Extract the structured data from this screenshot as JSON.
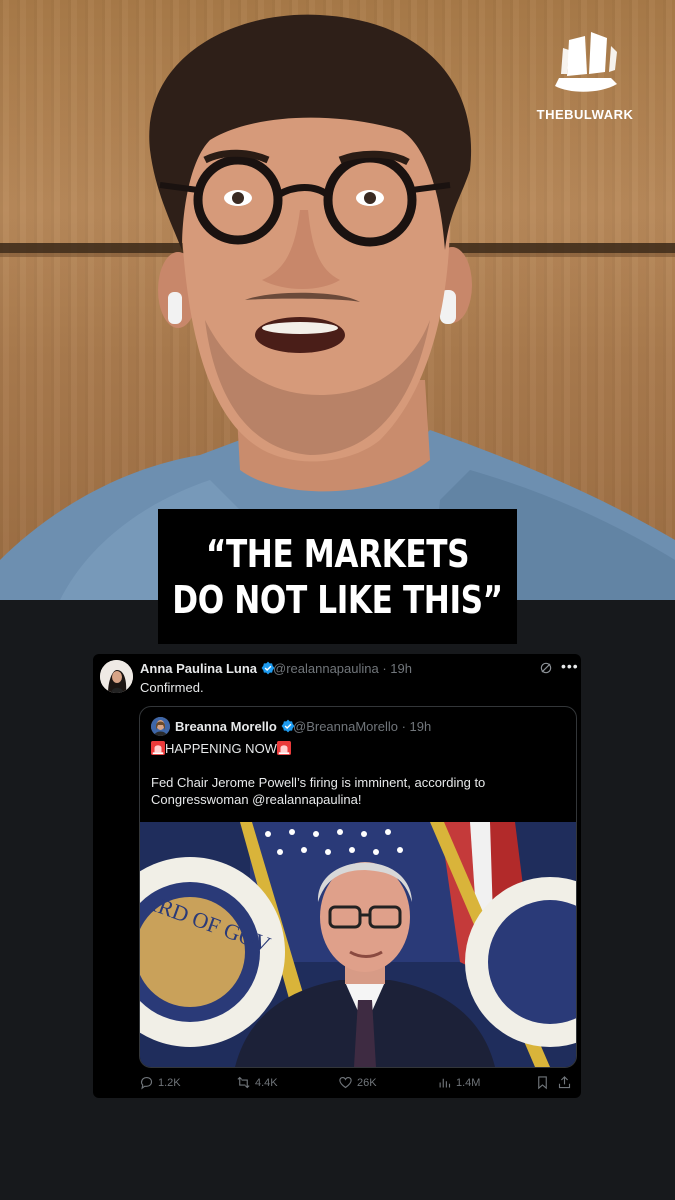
{
  "video": {
    "logo_text": "THEBULWARK",
    "caption_line1": "“THE MARKETS",
    "caption_line2": "DO NOT LIKE THIS”"
  },
  "tweet": {
    "author_name": "Anna Paulina Luna",
    "author_handle": "@realannapaulina · 19h",
    "text": "Confirmed.",
    "quote": {
      "author_name": "Breanna Morello",
      "author_handle": "@BreannaMorello · 19h",
      "line1": "HAPPENING NOW",
      "line2": "Fed Chair Jerome Powell’s firing is imminent, according to Congresswoman @realannapaulina!"
    },
    "stats": {
      "replies": "1.2K",
      "reposts": "4.4K",
      "likes": "26K",
      "views": "1.4M"
    }
  },
  "icons": [
    "verified-badge-icon",
    "grok-icon",
    "more-icon",
    "siren-icon",
    "reply-icon",
    "repost-icon",
    "like-icon",
    "views-icon",
    "bookmark-icon",
    "share-icon",
    "ship-logo-icon"
  ],
  "colors": {
    "verified": "#1d9bf0",
    "card_bg": "#000000",
    "page_bg": "#17191c",
    "muted_text": "#71767b"
  }
}
